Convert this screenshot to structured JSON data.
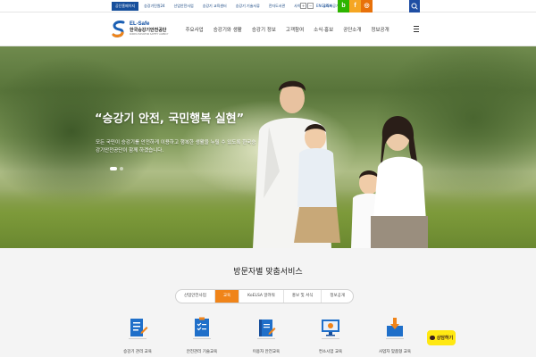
{
  "topbar": {
    "links": [
      "공단홈페이지",
      "승강기민원24",
      "산업안전사업",
      "승강기 교육센터",
      "승강기 기술서류",
      "전자도서관",
      "사이버홍보관",
      "공직자공개"
    ],
    "active_index": 0,
    "font_buttons": [
      "+",
      "−"
    ],
    "english": "ENGLISH",
    "sns": [
      {
        "icon": "blog-icon",
        "glyph": "b",
        "color": "#2db400"
      },
      {
        "icon": "facebook-icon",
        "glyph": "f",
        "color": "#f5a623"
      },
      {
        "icon": "instagram-icon",
        "glyph": "◎",
        "color": "#e8710a"
      }
    ],
    "search_icon": "search-icon"
  },
  "header": {
    "logo": {
      "brand": "EL-Safe",
      "org": "한국승강기안전공단",
      "org_en": "KOREA ELEVATOR SAFETY AGENCY"
    },
    "gnb": [
      "주요사업",
      "승강기와 생활",
      "승강기 정보",
      "고객참여",
      "소식·홍보",
      "공단소개",
      "정보공개"
    ],
    "menu_icon": "hamburger-menu-icon"
  },
  "hero": {
    "title": "“승강기 안전, 국민행복 실현”",
    "description": "모든 국민이 승강기를 안전하게 이용하고 행복한 생활을 누릴 수 있도록 한국승강기안전공단이 함께 하겠습니다.",
    "slides": 2,
    "active_slide": 0
  },
  "service": {
    "title": "방문자별 맞춤서비스",
    "tabs": [
      "산업안전사업",
      "교육",
      "KoELSA 알려줘",
      "홍보 및 서식",
      "정보공개"
    ],
    "active_tab": 1,
    "items": [
      {
        "label": "승강기 관리 교육",
        "icon": "document-edit-icon"
      },
      {
        "label": "안전관리 기술교육",
        "icon": "checklist-icon"
      },
      {
        "label": "이용자 안전교육",
        "icon": "book-edit-icon"
      },
      {
        "label": "컨소시엄 교육",
        "icon": "monitor-icon"
      },
      {
        "label": "사업자 맞춤형 교육",
        "icon": "download-box-icon"
      }
    ],
    "consult_label": "상담하기",
    "consult_icon": "chat-bubble-icon"
  },
  "colors": {
    "accent": "#f08419",
    "brand_blue": "#174f9c",
    "kakao_yellow": "#ffe812"
  }
}
